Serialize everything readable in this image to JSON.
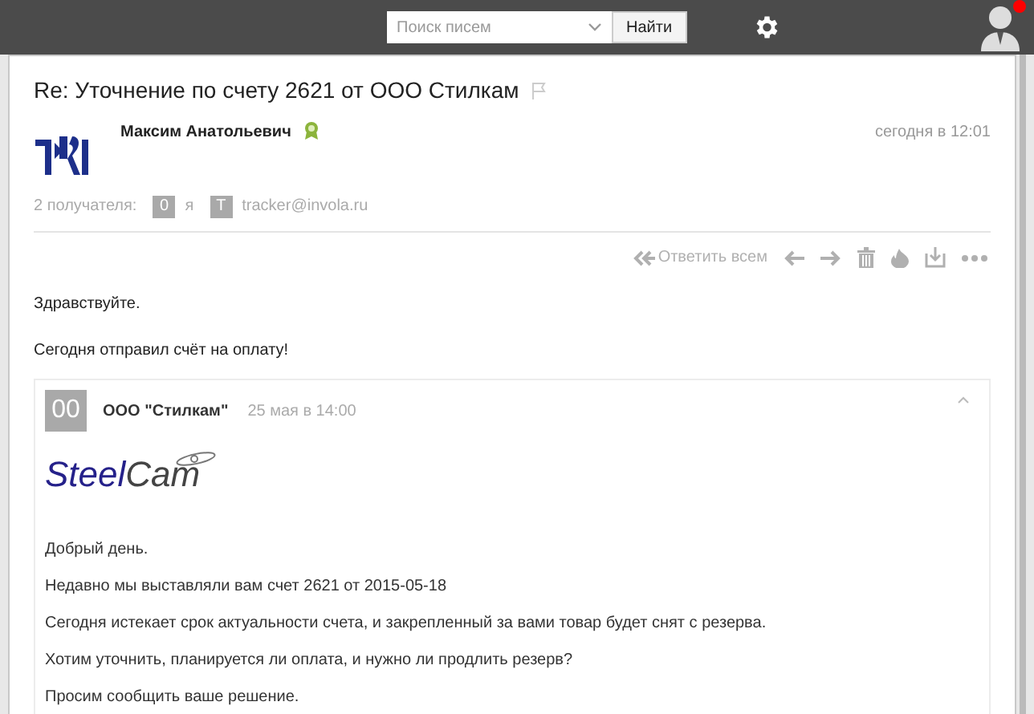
{
  "header": {
    "search": {
      "placeholder": "Поиск писем"
    },
    "search_button": "Найти",
    "notification": true
  },
  "message": {
    "subject": "Re: Уточнение по счету 2621 от ООО Стилкам",
    "flagged": false,
    "sender": "Максим Анатольевич",
    "verified": true,
    "time": "сегодня в 12:01",
    "recipients_label": "2 получателя:",
    "recipients": [
      {
        "initial": "0",
        "name": "я"
      },
      {
        "initial": "Т",
        "name": "tracker@invola.ru"
      }
    ],
    "toolbar": {
      "reply_all": "Ответить всем"
    },
    "body": [
      "Здравствуйте.",
      "Сегодня отправил счёт на оплату!"
    ],
    "quote": {
      "initials": "00",
      "sender": "ООО \"Стилкам\"",
      "time": "25 мая в 14:00",
      "expanded": true,
      "logo": {
        "part_1": "Steel",
        "part_2": "Cam"
      },
      "lines": [
        "Добрый день.",
        "Недавно мы выставляли вам счет 2621 от 2015-05-18",
        "Сегодня истекает срок актуальности счета, и закрепленный за вами товар будет снят с резерва.",
        "Хотим уточнить, планируется ли оплата, и нужно ли продлить резерв?",
        "Просим сообщить ваше решение."
      ]
    }
  }
}
